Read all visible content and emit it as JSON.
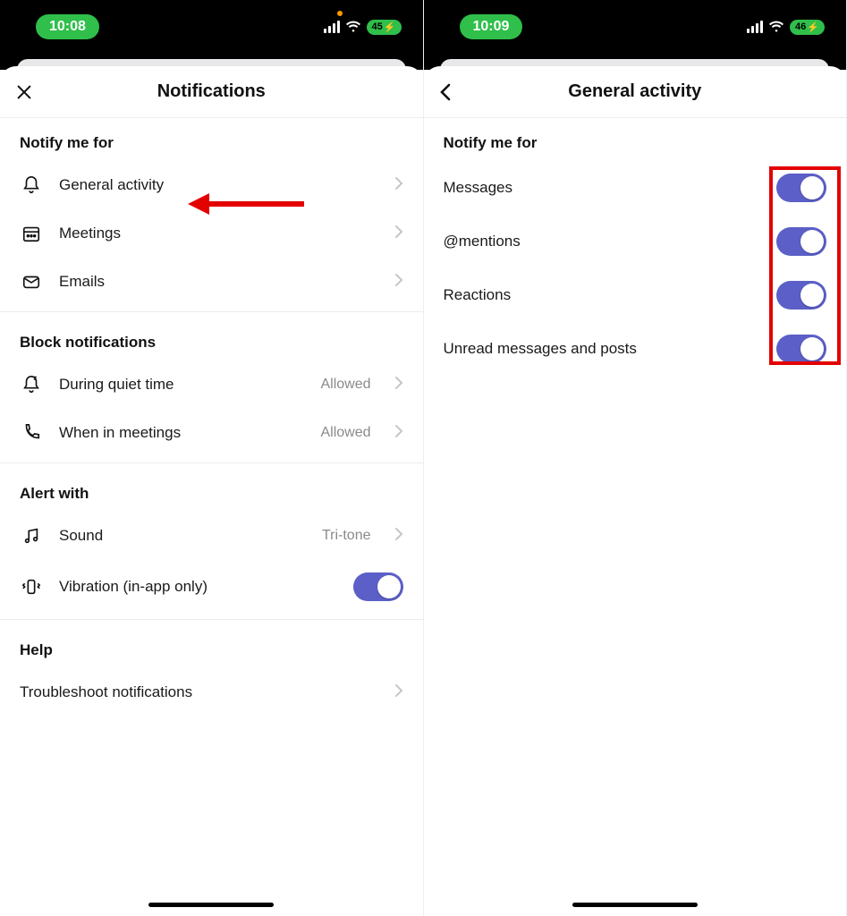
{
  "left": {
    "status": {
      "time": "10:08",
      "battery": "45"
    },
    "header": {
      "title": "Notifications"
    },
    "sections": {
      "notify_title": "Notify me for",
      "notify_items": [
        {
          "label": "General activity"
        },
        {
          "label": "Meetings"
        },
        {
          "label": "Emails"
        }
      ],
      "block_title": "Block notifications",
      "block_items": [
        {
          "label": "During quiet time",
          "value": "Allowed"
        },
        {
          "label": "When in meetings",
          "value": "Allowed"
        }
      ],
      "alert_title": "Alert with",
      "alert_items": [
        {
          "label": "Sound",
          "value": "Tri-tone"
        },
        {
          "label": "Vibration (in-app only)"
        }
      ],
      "help_title": "Help",
      "help_items": [
        {
          "label": "Troubleshoot notifications"
        }
      ]
    }
  },
  "right": {
    "status": {
      "time": "10:09",
      "battery": "46"
    },
    "header": {
      "title": "General activity"
    },
    "section_title": "Notify me for",
    "items": [
      {
        "label": "Messages",
        "on": true
      },
      {
        "label": "@mentions",
        "on": true
      },
      {
        "label": "Reactions",
        "on": true
      },
      {
        "label": "Unread messages and posts",
        "on": true
      }
    ]
  }
}
